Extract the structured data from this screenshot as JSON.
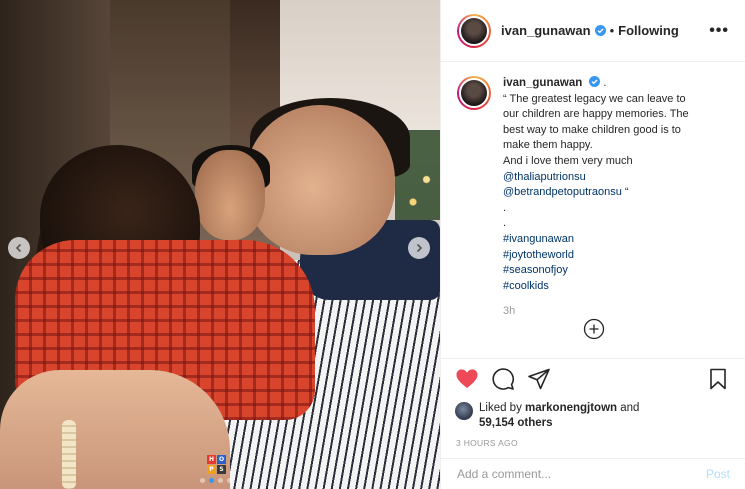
{
  "post": {
    "username": "ivan_gunawan",
    "separator": "•",
    "follow_status": "Following",
    "more_label": "•••",
    "caption_dot": ".",
    "caption_lines": [
      "“ The greatest legacy we can leave to",
      "our children are happy memories. The",
      "best way to make children good is to",
      "make them happy.",
      "And i love them very much"
    ],
    "mentions": [
      "@thaliaputrionsu",
      "@betrandpetoputraonsu “"
    ],
    "dots": [
      ".",
      "."
    ],
    "hashtags": [
      "#ivangunawan",
      "#joytotheworld",
      "#seasonofjoy",
      "#coolkids"
    ],
    "time_ago": "3h"
  },
  "engagement": {
    "liked_by_prefix": "Liked by",
    "liked_by_user": "markonengjtown",
    "and_word": "and",
    "others_count": "59,154 others",
    "posted_time": "3 HOURS AGO"
  },
  "comment": {
    "placeholder": "Add a comment...",
    "post_label": "Post"
  },
  "watermark": {
    "letters": [
      "H",
      "O",
      "P",
      "S"
    ]
  },
  "carousel": {
    "slide_count": 4,
    "active_index": 1
  },
  "colors": {
    "like": "#ed4956",
    "link": "#003569",
    "verified": "#3897f0",
    "watermark": [
      "#e63a2e",
      "#2a62c9",
      "#f0a020",
      "#3a3a3a"
    ]
  },
  "icons": {
    "like": "heart-icon",
    "comment": "comment-icon",
    "share": "paper-plane-icon",
    "save": "bookmark-icon",
    "add": "plus-circle-icon"
  }
}
